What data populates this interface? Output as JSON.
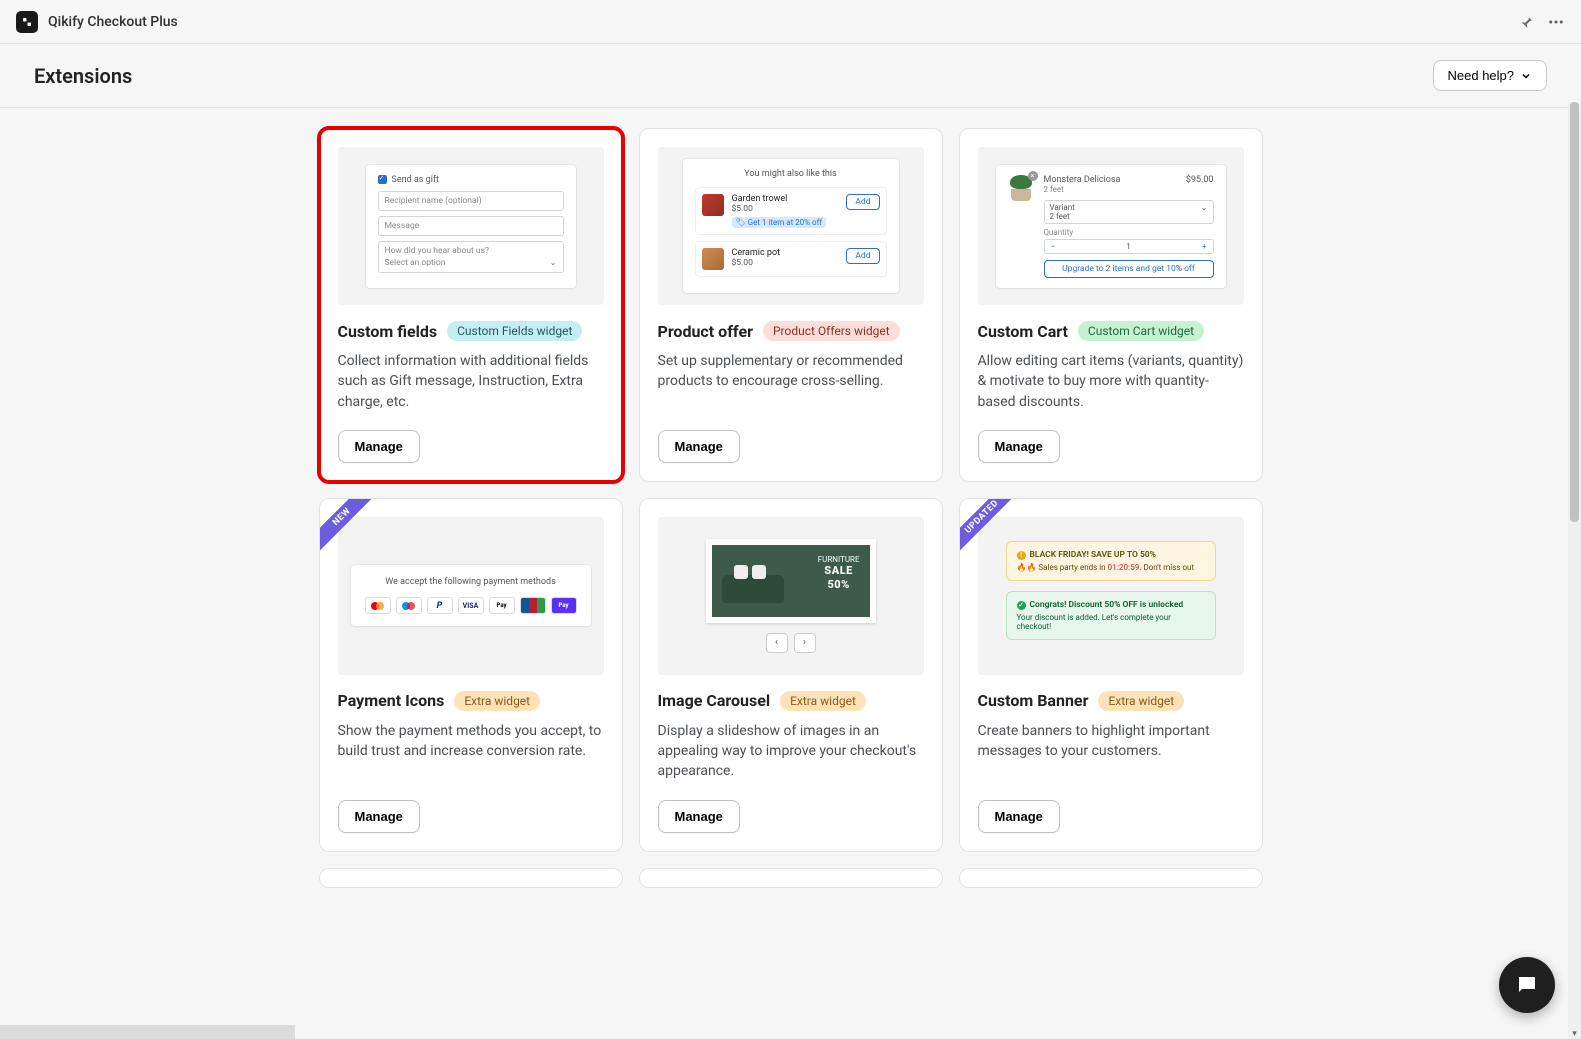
{
  "app": {
    "name": "Qikify Checkout Plus"
  },
  "page": {
    "title": "Extensions",
    "help_label": "Need help?"
  },
  "manage_label": "Manage",
  "ribbons": {
    "new": "NEW",
    "updated": "UPDATED"
  },
  "cards": [
    {
      "title": "Custom fields",
      "badge": "Custom Fields widget",
      "badge_style": "cyan",
      "desc": "Collect information with additional fields such as Gift message, Instruction, Extra charge, etc.",
      "highlight": true,
      "preview": {
        "type": "custom_fields",
        "checkbox_label": "Send as gift",
        "fields": [
          "Recipient name (optional)",
          "Message"
        ],
        "select_label": "How did you hear about us?",
        "select_placeholder": "Select an option"
      }
    },
    {
      "title": "Product offer",
      "badge": "Product Offers widget",
      "badge_style": "pink",
      "desc": "Set up supplementary or recommended products to encourage cross-selling.",
      "preview": {
        "type": "product_offer",
        "heading": "You might also like this",
        "items": [
          {
            "name": "Garden trowel",
            "price": "$5.00",
            "promo": "Get 1 item at 20% off",
            "add": "Add"
          },
          {
            "name": "Ceramic pot",
            "price": "$5.00",
            "add": "Add"
          }
        ]
      }
    },
    {
      "title": "Custom Cart",
      "badge": "Custom Cart widget",
      "badge_style": "green",
      "desc": "Allow editing cart items (variants, quantity) & motivate to buy more with quantity-based discounts.",
      "preview": {
        "type": "custom_cart",
        "product": "Monstera Deliciosa",
        "sub": "2 feet",
        "price": "$95.00",
        "variant_label": "Variant",
        "variant_value": "2 feet",
        "qty_label": "Quantity",
        "qty_value": "1",
        "upsell": "Upgrade to 2 items and get 10% off"
      }
    },
    {
      "title": "Payment Icons",
      "badge": "Extra widget",
      "badge_style": "orange",
      "desc": "Show the payment methods you accept, to build trust and increase conversion rate.",
      "ribbon": "new",
      "preview": {
        "type": "payment_icons",
        "text": "We accept the following payment methods",
        "methods": [
          "mc",
          "ma",
          "pp",
          "visa",
          "ap",
          "jcb",
          "sp"
        ]
      }
    },
    {
      "title": "Image Carousel",
      "badge": "Extra widget",
      "badge_style": "orange",
      "desc": "Display a slideshow of images in an appealing way to improve your checkout's appearance.",
      "preview": {
        "type": "carousel",
        "line1": "FURNITURE",
        "line2": "SALE",
        "line3": "50%"
      }
    },
    {
      "title": "Custom Banner",
      "badge": "Extra widget",
      "badge_style": "orange",
      "desc": "Create banners to highlight important messages to your customers.",
      "ribbon": "updated",
      "preview": {
        "type": "banner",
        "banner1": {
          "title": "BLACK FRIDAY! SAVE UP TO 50%",
          "sub_pre": "Sales party ends in ",
          "time": "01:20:59",
          "sub_post": ". Don't miss out"
        },
        "banner2": {
          "title": "Congrats! Discount 50% OFF is unlocked",
          "sub": "Your discount is added. Let's complete your checkout!"
        }
      }
    }
  ]
}
